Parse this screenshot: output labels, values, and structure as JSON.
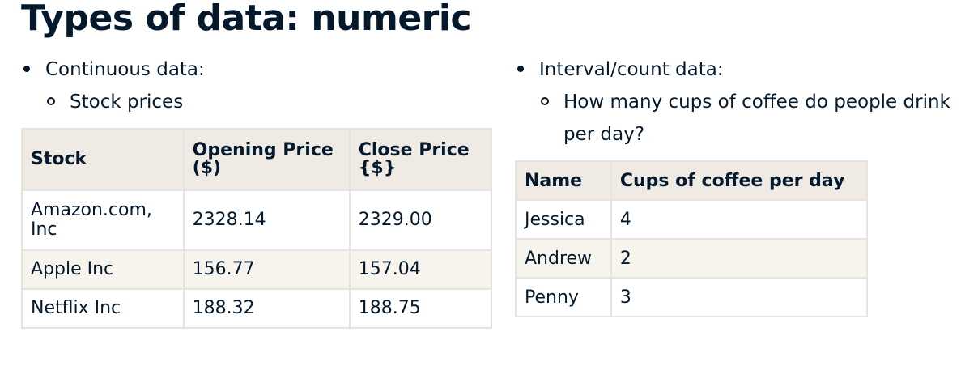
{
  "title": "Types of data: numeric",
  "left": {
    "bullet": "Continuous data:",
    "subbullet": "Stock prices",
    "table": {
      "headers": [
        "Stock",
        "Opening Price ($)",
        "Close Price {$}"
      ],
      "rows": [
        [
          "Amazon.com, Inc",
          "2328.14",
          "2329.00"
        ],
        [
          "Apple Inc",
          "156.77",
          "157.04"
        ],
        [
          "Netflix Inc",
          "188.32",
          "188.75"
        ]
      ]
    }
  },
  "right": {
    "bullet": "Interval/count data:",
    "subbullet": "How many cups of coffee do people drink per day?",
    "table": {
      "headers": [
        "Name",
        "Cups of coffee per day"
      ],
      "rows": [
        [
          "Jessica",
          "4"
        ],
        [
          "Andrew",
          "2"
        ],
        [
          "Penny",
          "3"
        ]
      ]
    }
  }
}
